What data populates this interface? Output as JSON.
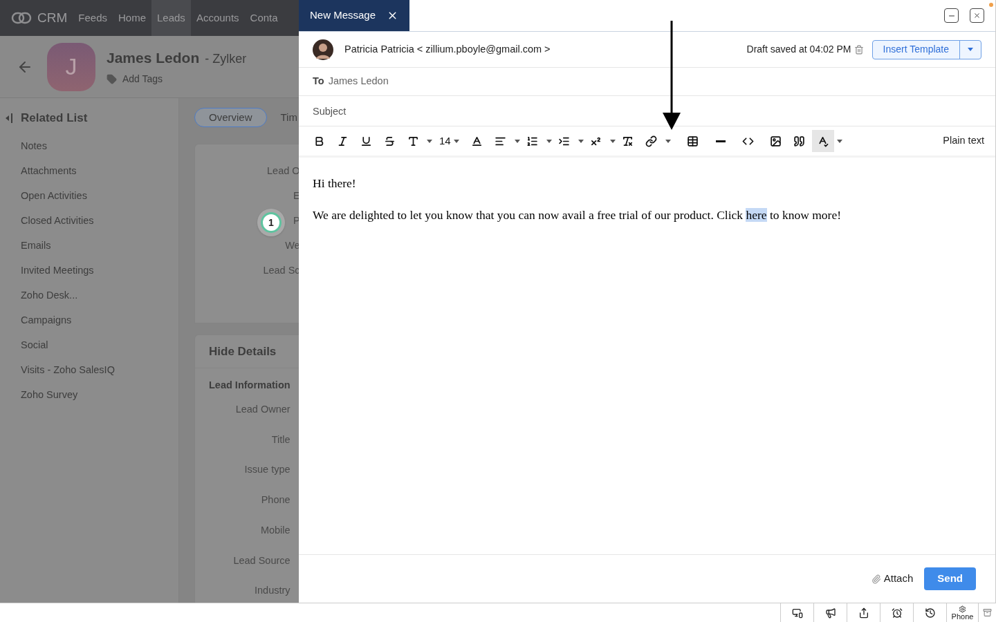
{
  "crm": {
    "logo": "CRM",
    "nav": [
      {
        "label": "Feeds",
        "selected": false
      },
      {
        "label": "Home",
        "selected": false
      },
      {
        "label": "Leads",
        "selected": true
      },
      {
        "label": "Accounts",
        "selected": false
      },
      {
        "label": "Conta",
        "selected": false
      }
    ],
    "record": {
      "initial": "J",
      "name": "James Ledon",
      "company": "- Zylker",
      "add_tags": "Add Tags"
    },
    "related_list": {
      "title": "Related List",
      "items": [
        "Notes",
        "Attachments",
        "Open Activities",
        "Closed Activities",
        "Emails",
        "Invited Meetings",
        "Zoho Desk...",
        "Campaigns",
        "Social",
        "Visits - Zoho SalesIQ",
        "Zoho Survey"
      ]
    },
    "tabs": [
      {
        "label": "Overview",
        "selected": true
      },
      {
        "label": "Tim",
        "selected": false
      }
    ],
    "overview_fields": [
      "Lead O",
      "E",
      "P",
      "We",
      "Lead Sc"
    ],
    "step_badge": "1",
    "details": {
      "toggle": "Hide Details",
      "section": "Lead Information",
      "fields": [
        "Lead Owner",
        "Title",
        "Issue type",
        "Phone",
        "Mobile",
        "Lead Source",
        "Industry"
      ]
    }
  },
  "compose": {
    "title": "New Message",
    "from": "Patricia Patricia < zillium.pboyle@gmail.com >",
    "draft_status": "Draft saved at 04:02 PM",
    "insert_template": "Insert Template",
    "to_label": "To",
    "to_value": "James Ledon",
    "subject_placeholder": "Subject",
    "toolbar": {
      "font_size": "14",
      "spellcheck_active": true,
      "plain_text": "Plain text"
    },
    "body": {
      "greeting": "Hi there!",
      "before": "We are delighted to let you know that you can now avail a free trial of our product. Click ",
      "selected_word": "here",
      "after": " to know more!",
      "word_selected": true
    },
    "attach": "Attach",
    "send": "Send"
  },
  "status_bar": {
    "phone": "Phone"
  }
}
